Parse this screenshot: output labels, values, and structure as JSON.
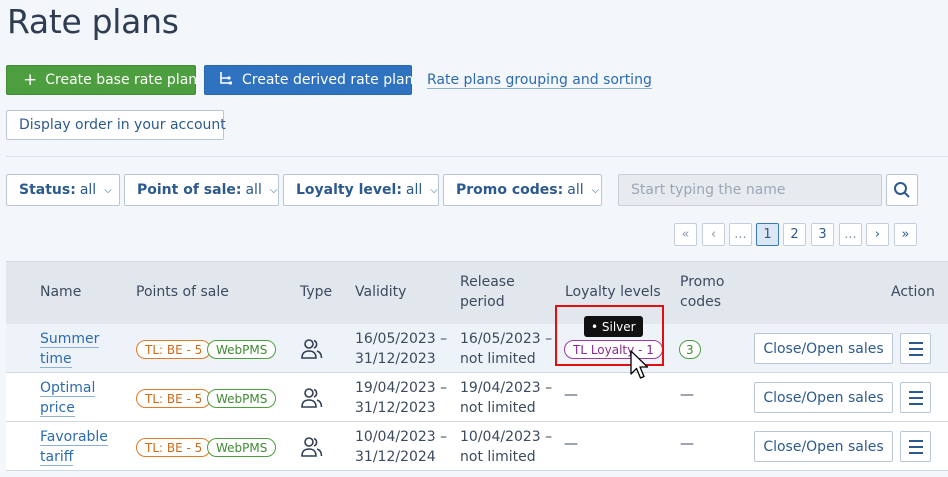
{
  "page": {
    "title": "Rate plans"
  },
  "actions": {
    "create_base": "Create base rate plan",
    "create_derived": "Create derived rate plan",
    "grouping_link": "Rate plans grouping and sorting",
    "display_order": "Display order in your account"
  },
  "filters": {
    "status": {
      "label": "Status:",
      "value": "all"
    },
    "point_of_sale": {
      "label": "Point of sale:",
      "value": "all"
    },
    "loyalty_level": {
      "label": "Loyalty level:",
      "value": "all"
    },
    "promo_codes": {
      "label": "Promo codes:",
      "value": "all"
    },
    "search_placeholder": "Start typing the name"
  },
  "pagination": {
    "first": "«",
    "prev": "‹",
    "ellipsis_left": "...",
    "pages": [
      "1",
      "2",
      "3"
    ],
    "current": "1",
    "ellipsis_right": "...",
    "next": "›",
    "last": "»"
  },
  "table": {
    "headers": {
      "name": "Name",
      "points_of_sale": "Points of sale",
      "type": "Type",
      "validity": "Validity",
      "release_line1": "Release",
      "release_line2": "period",
      "loyalty": "Loyalty levels",
      "promo_line1": "Promo",
      "promo_line2": "codes",
      "action": "Action"
    },
    "rows": [
      {
        "name_line1": "Summer",
        "name_line2": "time",
        "pos_tags": [
          "TL: BE - 5",
          "WebPMS"
        ],
        "validity_line1": "16/05/2023 –",
        "validity_line2": "31/12/2023",
        "release_line1": "16/05/2023 –",
        "release_line2": "not limited",
        "loyalty": "TL Loyalty - 1",
        "promo": "3",
        "action": "Close/Open sales"
      },
      {
        "name_line1": "Optimal",
        "name_line2": "price",
        "pos_tags": [
          "TL: BE - 5",
          "WebPMS"
        ],
        "validity_line1": "19/04/2023 –",
        "validity_line2": "31/12/2023",
        "release_line1": "19/04/2023 –",
        "release_line2": "not limited",
        "loyalty": "—",
        "promo": "—",
        "action": "Close/Open sales"
      },
      {
        "name_line1": "Favorable",
        "name_line2": "tariff",
        "pos_tags": [
          "TL: BE - 5",
          "WebPMS"
        ],
        "validity_line1": "10/04/2023 –",
        "validity_line2": "31/12/2024",
        "release_line1": "10/04/2023 –",
        "release_line2": "not limited",
        "loyalty": "—",
        "promo": "—",
        "action": "Close/Open sales"
      }
    ]
  },
  "tooltip": {
    "text": "• Silver"
  },
  "colors": {
    "primary_green": "#4d9e3f",
    "primary_blue": "#2f73c0",
    "tag_orange": "#e07a28",
    "tag_purple": "#9a3aa0",
    "highlight_red": "#e01010"
  }
}
